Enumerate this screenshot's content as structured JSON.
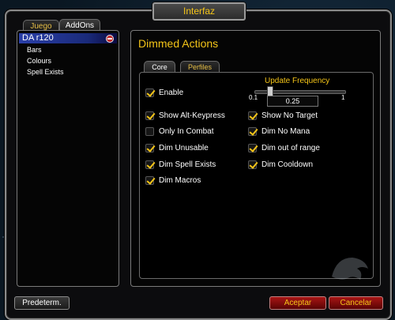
{
  "window": {
    "title": "Interfaz"
  },
  "tabs": [
    {
      "label": "Juego",
      "active": false
    },
    {
      "label": "AddOns",
      "active": true
    }
  ],
  "addon_list": {
    "root": {
      "label": "DA r120",
      "selected": true
    },
    "children": [
      {
        "label": "Bars"
      },
      {
        "label": "Colours"
      },
      {
        "label": "Spell Exists"
      }
    ]
  },
  "panel": {
    "title": "Dimmed Actions",
    "subtabs": [
      {
        "label": "Core",
        "active": true
      },
      {
        "label": "Perfiles",
        "active": false
      }
    ]
  },
  "options": {
    "enable": {
      "label": "Enable",
      "checked": true
    },
    "show_alt_keypress": {
      "label": "Show Alt-Keypress",
      "checked": true
    },
    "only_in_combat": {
      "label": "Only In Combat",
      "checked": false
    },
    "dim_unusable": {
      "label": "Dim Unusable",
      "checked": true
    },
    "dim_spell_exists": {
      "label": "Dim Spell Exists",
      "checked": true
    },
    "dim_macros": {
      "label": "Dim Macros",
      "checked": true
    },
    "show_no_target": {
      "label": "Show No Target",
      "checked": true
    },
    "dim_no_mana": {
      "label": "Dim No Mana",
      "checked": true
    },
    "dim_out_of_range": {
      "label": "Dim out of range",
      "checked": true
    },
    "dim_cooldown": {
      "label": "Dim Cooldown",
      "checked": true
    }
  },
  "update_frequency": {
    "label": "Update Frequency",
    "min": "0.1",
    "max": "1",
    "value": "0.25"
  },
  "buttons": {
    "defaults": "Predeterm.",
    "accept": "Aceptar",
    "cancel": "Cancelar"
  },
  "colors": {
    "accent_gold": "#f5c518",
    "selection_blue": "#2a3fa8",
    "button_red": "#a81515"
  }
}
